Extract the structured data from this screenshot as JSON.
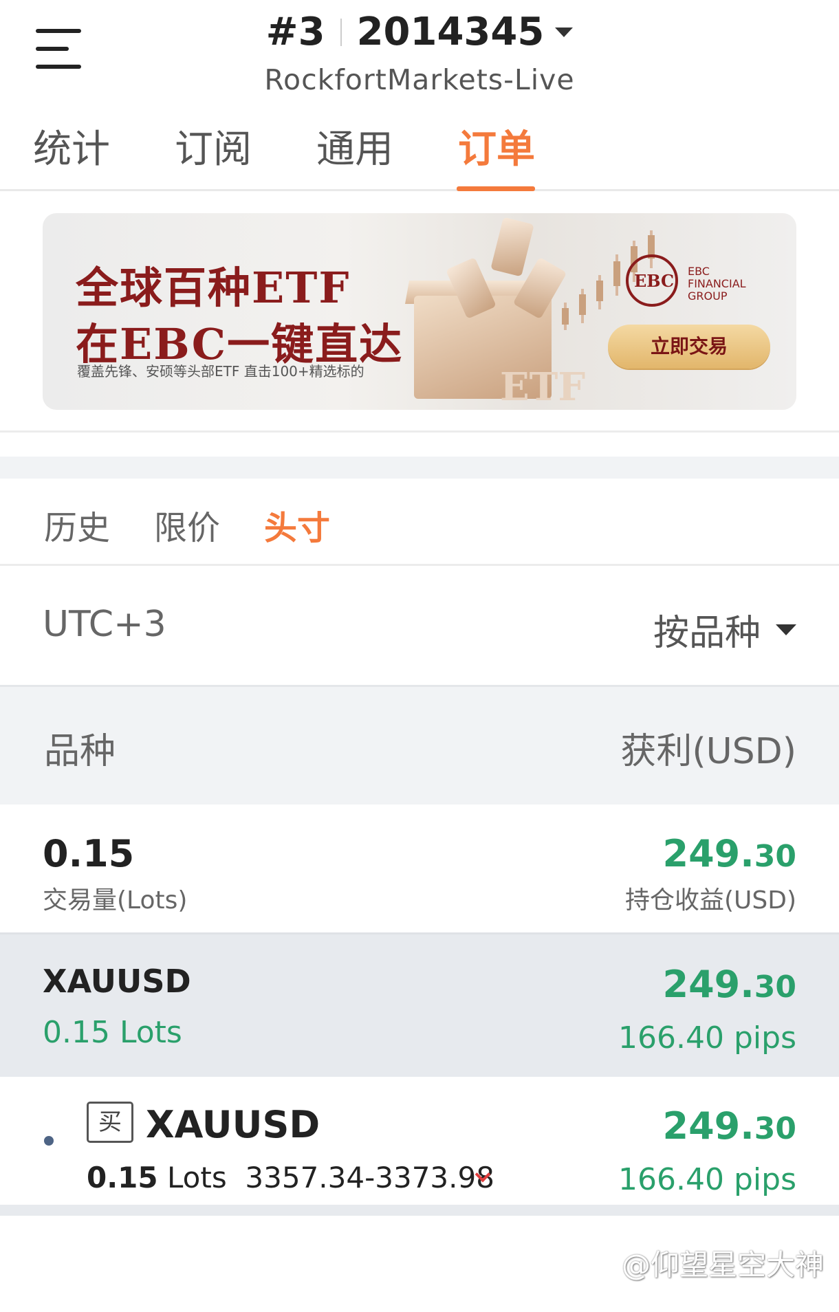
{
  "header": {
    "account_index": "#3",
    "account_number": "2014345",
    "server": "RockfortMarkets-Live"
  },
  "tabs": [
    {
      "label": "统计"
    },
    {
      "label": "订阅"
    },
    {
      "label": "通用"
    },
    {
      "label": "订单",
      "active": true
    }
  ],
  "banner": {
    "title_line1": "全球百种ETF",
    "title_line2": "在EBC一键直达",
    "subtitle": "覆盖先锋、安硕等头部ETF 直击100+精选标的",
    "brand_line1": "EBC",
    "brand_line2": "FINANCIAL",
    "brand_line3": "GROUP",
    "cta": "立即交易",
    "product_text": "ETF"
  },
  "subtabs": [
    {
      "label": "历史"
    },
    {
      "label": "限价"
    },
    {
      "label": "头寸",
      "active": true
    }
  ],
  "filter": {
    "timezone": "UTC+3",
    "sort_label": "按品种"
  },
  "columns": {
    "symbol": "品种",
    "profit": "获利(USD)"
  },
  "summary": {
    "volume": "0.15",
    "volume_label": "交易量(Lots)",
    "profit_main": "249.",
    "profit_cents": "30",
    "profit_label": "持仓收益(USD)"
  },
  "group": {
    "symbol": "XAUUSD",
    "lots": "0.15 Lots",
    "profit_main": "249.",
    "profit_cents": "30",
    "pips": "166.40 pips"
  },
  "position": {
    "side": "买",
    "symbol": "XAUUSD",
    "lots": "0.15",
    "lots_unit": "Lots",
    "price_range": "3357.34-3373.98",
    "profit_main": "249.",
    "profit_cents": "30",
    "pips": "166.40 pips"
  },
  "watermark": "@仰望星空大神",
  "colors": {
    "accent": "#f47a3c",
    "profit_green": "#2aa06b",
    "loss_red": "#e03c3c",
    "brand_red": "#8a1c1c"
  }
}
